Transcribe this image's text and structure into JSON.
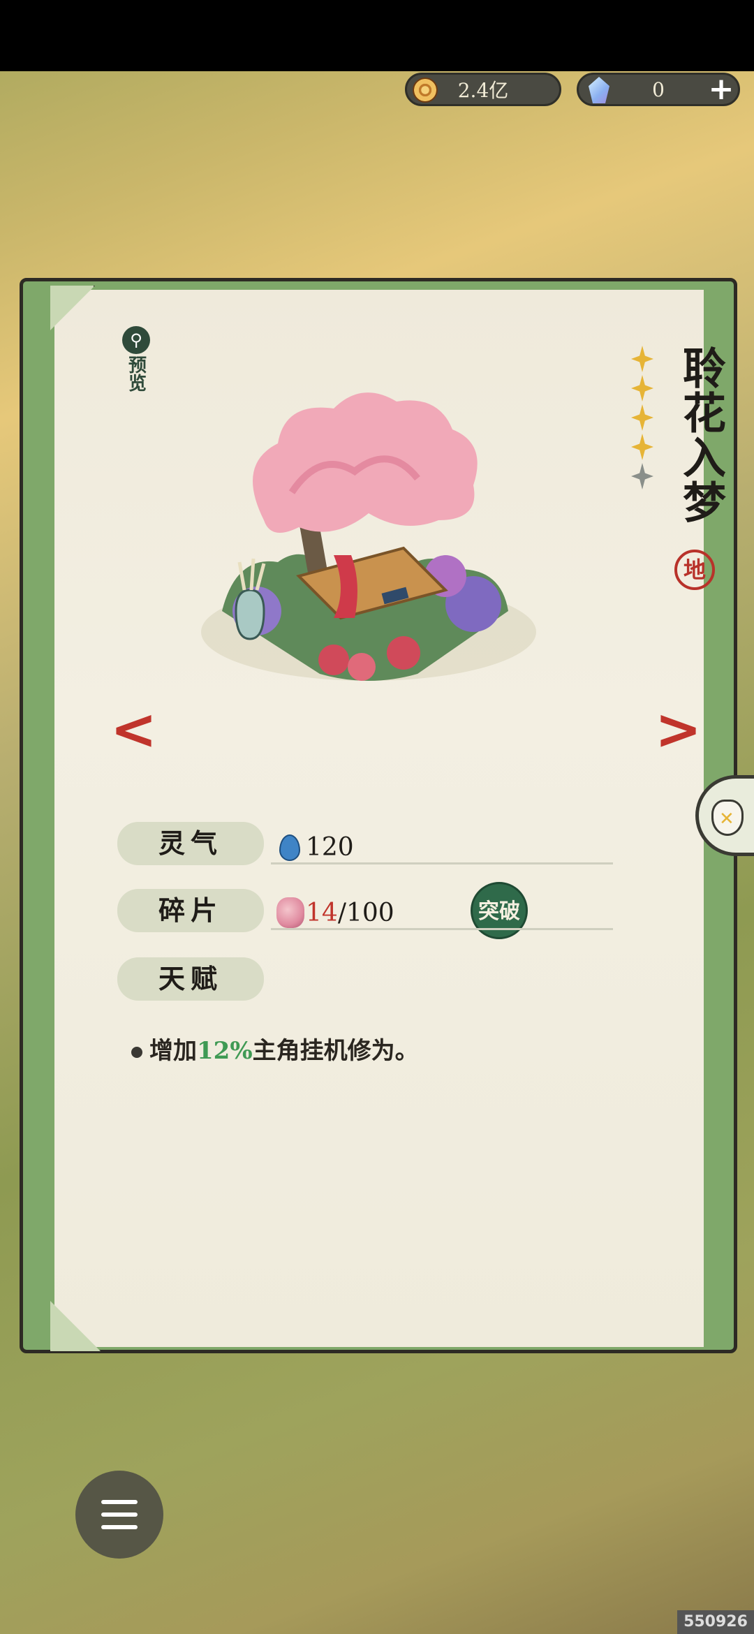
{
  "currency": {
    "coins": "2.4亿",
    "gems": "0",
    "plus_label": "+"
  },
  "card": {
    "title": "聆花入梦",
    "grade": "地",
    "stars_filled": 4,
    "stars_total": 5,
    "preview_label": "预览",
    "prev_label": "<",
    "next_label": ">"
  },
  "stats": {
    "lingqi_label": "灵气",
    "lingqi_value": "120",
    "shard_label": "碎片",
    "shard_current": "14",
    "shard_total": "/100",
    "breakthrough_label": "突破",
    "talent_label": "天赋",
    "talent_text_before": "增加",
    "talent_highlight": "12%",
    "talent_text_after": "主角挂机修为。"
  },
  "colors": {
    "accent_red": "#c0342b",
    "accent_green": "#3f9a54",
    "star_gold": "#e6b436"
  },
  "watermark": "550926"
}
